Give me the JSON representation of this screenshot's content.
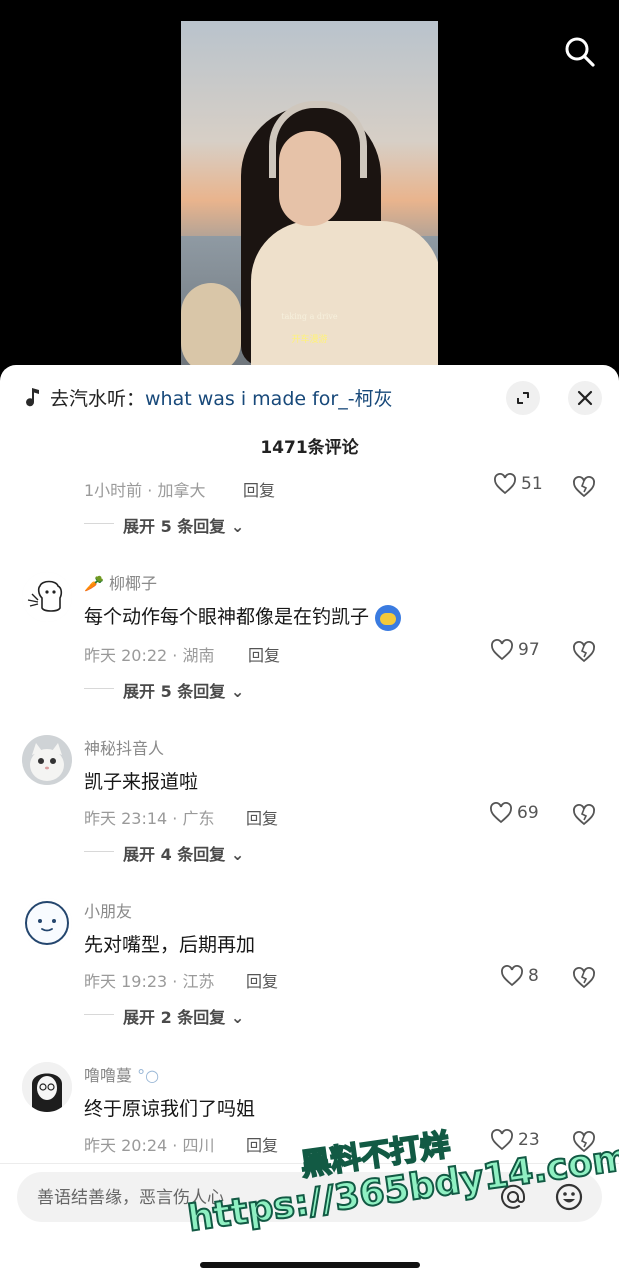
{
  "video": {
    "subtitle_en": "taking a drive",
    "subtitle_zh": "开车漫游"
  },
  "music": {
    "prefix": "去汽水听：",
    "song": "what was i made for_-柯灰"
  },
  "comments_header": {
    "title": "1471条评论"
  },
  "comments": [
    {
      "username": "",
      "content": "",
      "time": "1小时前 · 加拿大",
      "reply_label": "回复",
      "likes": "51",
      "expand_label": "展开 5 条回复"
    },
    {
      "username": "柳椰子",
      "content": "每个动作每个眼神都像是在钓凯子",
      "time": "昨天 20:22 · 湖南",
      "reply_label": "回复",
      "likes": "97",
      "expand_label": "展开 5 条回复"
    },
    {
      "username": "神秘抖音人",
      "content": "凯子来报道啦",
      "time": "昨天 23:14 · 广东",
      "reply_label": "回复",
      "likes": "69",
      "expand_label": "展开 4 条回复"
    },
    {
      "username": "小朋友",
      "content": "先对嘴型，后期再加",
      "time": "昨天 19:23 · 江苏",
      "reply_label": "回复",
      "likes": "8",
      "expand_label": "展开 2 条回复"
    },
    {
      "username": "噜噜蔓",
      "content": "终于原谅我们了吗姐",
      "time": "昨天 20:24 · 四川",
      "reply_label": "回复",
      "likes": "23"
    }
  ],
  "input": {
    "placeholder": "善语结善缘，恶言伤人心"
  },
  "watermark": {
    "line1": "黑料不打烊",
    "line2": "https://365bdy14.com"
  },
  "icons": {
    "search": "search-icon",
    "music": "music-note-icon",
    "expand": "expand-icon",
    "close": "close-icon",
    "like": "heart-icon",
    "dislike": "broken-heart-icon",
    "at": "at-icon",
    "emoji": "emoji-icon"
  },
  "colors": {
    "song_link": "#18497a",
    "background": "#ffffff",
    "video_bg": "#000000"
  }
}
